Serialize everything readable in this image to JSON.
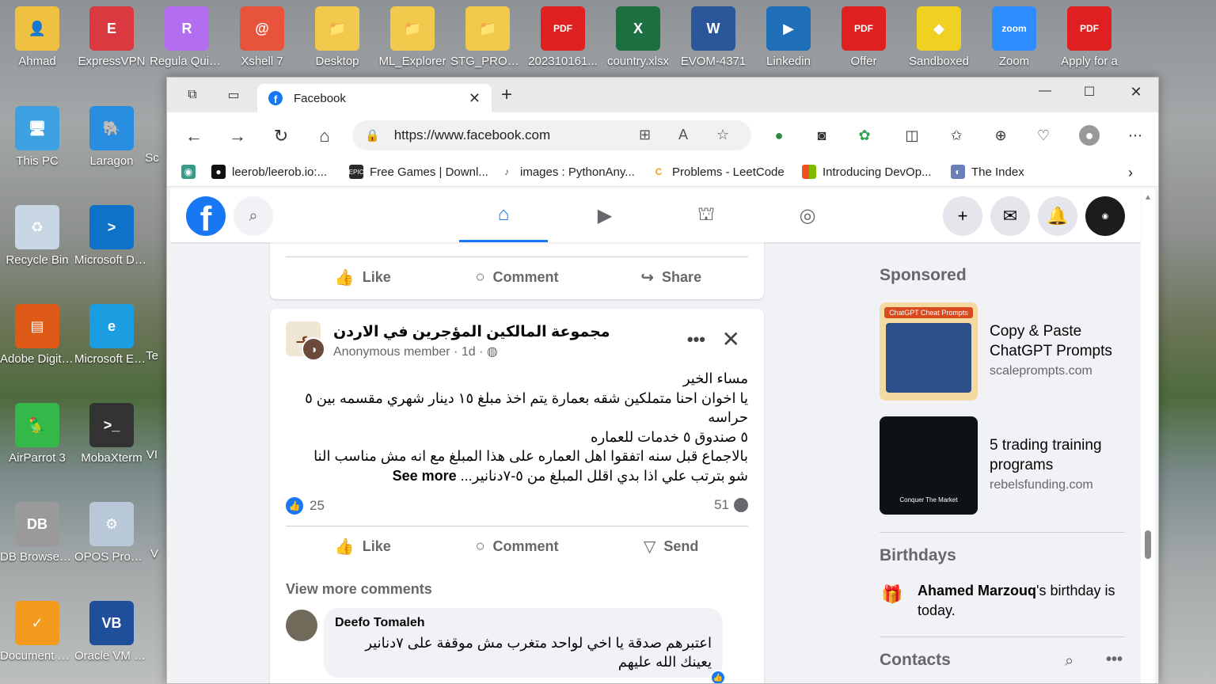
{
  "desktop": {
    "icons": [
      {
        "label": "Ahmad",
        "color": "#f0c040",
        "glyph": "👤"
      },
      {
        "label": "ExpressVPN",
        "color": "#da3940",
        "glyph": "E"
      },
      {
        "label": "Regula Quick ...",
        "color": "#b36ef0",
        "glyph": "R"
      },
      {
        "label": "Xshell 7",
        "color": "#e8533b",
        "glyph": "@"
      },
      {
        "label": "Desktop",
        "color": "#f2c94c",
        "glyph": "📁"
      },
      {
        "label": "ML_Explorer",
        "color": "#f2c94c",
        "glyph": "📁"
      },
      {
        "label": "STG_PRO_P...",
        "color": "#f2c94c",
        "glyph": "📁"
      },
      {
        "label": "202310161...",
        "color": "#e02020",
        "glyph": "PDF"
      },
      {
        "label": "country.xlsx",
        "color": "#1d6f42",
        "glyph": "X"
      },
      {
        "label": "EVOM-4371",
        "color": "#2b579a",
        "glyph": "W"
      },
      {
        "label": "Linkedin",
        "color": "#1e6fb8",
        "glyph": "▶"
      },
      {
        "label": "Offer",
        "color": "#e02020",
        "glyph": "PDF"
      },
      {
        "label": "Sandboxed",
        "color": "#f0d020",
        "glyph": "◆"
      },
      {
        "label": "Zoom",
        "color": "#2d8cff",
        "glyph": "zoom"
      },
      {
        "label": "Apply for a",
        "color": "#e02020",
        "glyph": "PDF"
      },
      {
        "label": "This PC",
        "color": "#3da0e0",
        "glyph": "🖥"
      },
      {
        "label": "Laragon",
        "color": "#2a8ee0",
        "glyph": "🐘"
      },
      {
        "label": "Recycle Bin",
        "color": "#c9d6e4",
        "glyph": "♻"
      },
      {
        "label": "Microsoft Data Mi...",
        "color": "#0e72c9",
        "glyph": ">"
      },
      {
        "label": "Adobe Digital Ed...",
        "color": "#e05a17",
        "glyph": "▤"
      },
      {
        "label": "Microsoft Edge",
        "color": "#1b9de2",
        "glyph": "e"
      },
      {
        "label": "AirParrot 3",
        "color": "#35b84a",
        "glyph": "🦜"
      },
      {
        "label": "MobaXterm",
        "color": "#333333",
        "glyph": ">_"
      },
      {
        "label": "DB Browser (SQLite)",
        "color": "#9a9a9a",
        "glyph": "DB"
      },
      {
        "label": "OPOS Properti...",
        "color": "#b8c8d8",
        "glyph": "⚙"
      },
      {
        "label": "Document Reader",
        "color": "#f39a1e",
        "glyph": "✓"
      },
      {
        "label": "Oracle VM VirtualBox",
        "color": "#1f4e9b",
        "glyph": "VB"
      }
    ],
    "partial_labels": [
      "Sc",
      "Te",
      "VI",
      "V"
    ]
  },
  "browser": {
    "tab_title": "Facebook",
    "url": "https://www.facebook.com",
    "favorites": [
      {
        "label": "leerob/leerob.io:...",
        "icon": "github-icon",
        "color": "#111111"
      },
      {
        "label": "Free Games | Downl...",
        "icon": "epic-icon",
        "color": "#2a2a2a"
      },
      {
        "label": "images : PythonAny...",
        "icon": "python-icon",
        "color": "#555555"
      },
      {
        "label": "Problems - LeetCode",
        "icon": "leetcode-icon",
        "color": "#f89f1b"
      },
      {
        "label": "Introducing DevOp...",
        "icon": "microsoft-icon",
        "color": "#f25022"
      },
      {
        "label": "The Index",
        "icon": "index-icon",
        "color": "#6a7fb8"
      }
    ]
  },
  "facebook": {
    "top_post": {
      "like_label": "Like",
      "comment_label": "Comment",
      "share_label": "Share"
    },
    "post": {
      "group_name": "مجموعة المالكين المؤجرين في الاردن",
      "author": "Anonymous member",
      "time": "1d",
      "body_lines": [
        "مساء الخير",
        "يا اخوان احنا متملكين شقه بعمارة يتم اخذ مبلغ ١٥ دينار شهري مقسمه بين ٥ حراسه",
        "٥ صندوق ٥ خدمات للعماره",
        "بالاجماع قبل سنه اتفقوا اهل العماره على هذا المبلغ مع انه مش مناسب النا",
        "شو بترتب علي اذا بدي اقلل المبلغ من ٥-٧دنانير..."
      ],
      "see_more": "See more",
      "likes": "25",
      "comments": "51",
      "like_label": "Like",
      "comment_label": "Comment",
      "send_label": "Send",
      "view_more_comments": "View more comments",
      "comment": {
        "name": "Deefo Tomaleh",
        "text": "اعتبرهم صدقة يا اخي لواحد متغرب مش موقفة على ٧دنانير يعينك الله عليهم"
      }
    },
    "sidebar": {
      "sponsored": "Sponsored",
      "ads": [
        {
          "title": "Copy & Paste ChatGPT Prompts",
          "url": "scaleprompts.com",
          "img_text": "ChatGPT Cheat Prompts"
        },
        {
          "title": "5 trading training programs",
          "url": "rebelsfunding.com",
          "img_text": "Conquer The Market"
        }
      ],
      "birthdays": "Birthdays",
      "birthday_name": "Ahamed Marzouq",
      "birthday_text": "'s birthday is today.",
      "contacts": "Contacts"
    }
  },
  "colors": {
    "facebook_blue": "#1877f2",
    "text_secondary": "#65676b"
  }
}
